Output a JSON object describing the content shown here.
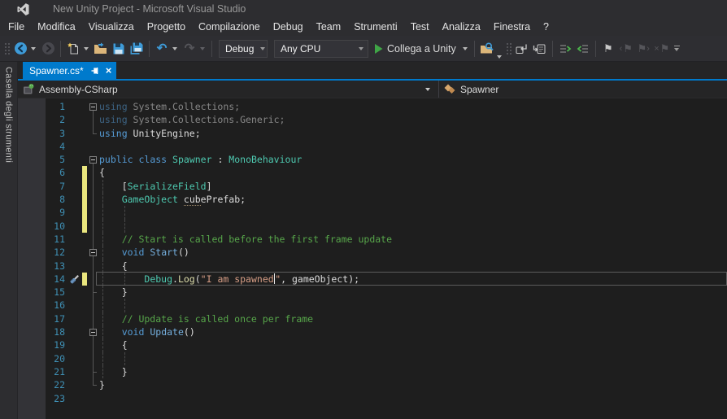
{
  "window": {
    "title": "New Unity Project - Microsoft Visual Studio"
  },
  "menu": [
    "File",
    "Modifica",
    "Visualizza",
    "Progetto",
    "Compilazione",
    "Debug",
    "Team",
    "Strumenti",
    "Test",
    "Analizza",
    "Finestra",
    "?"
  ],
  "toolbar": {
    "configuration": "Debug",
    "platform": "Any CPU",
    "attach": "Collega a Unity",
    "glyphs": {
      "undo": "↶",
      "redo": "↷",
      "flag": "⚑",
      "prev": "‹",
      "next": "›",
      "clear": "×"
    }
  },
  "document": {
    "tab": "Spawner.cs*",
    "close": "×",
    "project_dropdown": "Assembly-CSharp",
    "type_dropdown": "Spawner"
  },
  "toolbox": {
    "label": "Casella degli strumenti"
  },
  "colors": {
    "accent": "#007ACC",
    "editor_bg": "#1E1E1E",
    "chrome_bg": "#2D2D30",
    "keyword": "#569CD6",
    "type": "#4EC9B0",
    "unity_message": "#74AEDC",
    "method": "#DCDCAA",
    "string": "#D69D85",
    "comment": "#57A64A",
    "plain": "#DCDCDC",
    "line_number": "#3F90B5",
    "change_bar": "#EAE67E"
  },
  "code": {
    "language": "csharp",
    "lines": [
      {
        "n": 1,
        "ol": "b",
        "fold": true,
        "fade": true,
        "t": [
          [
            "k",
            "using"
          ],
          [
            "p",
            " System.Collections;"
          ]
        ]
      },
      {
        "n": 2,
        "ol": "f",
        "fade": true,
        "t": [
          [
            "k",
            "using"
          ],
          [
            "p",
            " System.Collections.Generic;"
          ]
        ]
      },
      {
        "n": 3,
        "ol": "t",
        "hook": true,
        "t": [
          [
            "k",
            "using"
          ],
          [
            "p",
            " UnityEngine;"
          ]
        ]
      },
      {
        "n": 4,
        "ol": "",
        "t": []
      },
      {
        "n": 5,
        "ol": "b",
        "fold": true,
        "t": [
          [
            "k",
            "public"
          ],
          [
            "p",
            " "
          ],
          [
            "k",
            "class"
          ],
          [
            "p",
            " "
          ],
          [
            "t",
            "Spawner"
          ],
          [
            "p",
            " : "
          ],
          [
            "t",
            "MonoBehaviour"
          ]
        ]
      },
      {
        "n": 6,
        "ol": "f",
        "chg": true,
        "t": [
          [
            "p",
            "{"
          ]
        ]
      },
      {
        "n": 7,
        "ol": "f",
        "chg": true,
        "g": [
          0
        ],
        "t": [
          [
            "p",
            "    ["
          ],
          [
            "t",
            "SerializeField"
          ],
          [
            "p",
            "]"
          ]
        ]
      },
      {
        "n": 8,
        "ol": "f",
        "chg": true,
        "g": [
          0
        ],
        "t": [
          [
            "p",
            "    "
          ],
          [
            "t",
            "GameObject"
          ],
          [
            "p",
            " "
          ],
          [
            "f",
            "cub"
          ],
          [
            "p",
            "ePrefab;"
          ]
        ]
      },
      {
        "n": 9,
        "ol": "f",
        "chg": true,
        "g": [
          0,
          1
        ],
        "t": []
      },
      {
        "n": 10,
        "ol": "f",
        "chg": true,
        "g": [
          0,
          1
        ],
        "t": []
      },
      {
        "n": 11,
        "ol": "f",
        "g": [
          0
        ],
        "t": [
          [
            "c",
            "    // Start is called before the first frame update"
          ]
        ]
      },
      {
        "n": 12,
        "ol": "f",
        "fold": true,
        "g": [
          0
        ],
        "t": [
          [
            "p",
            "    "
          ],
          [
            "k",
            "void"
          ],
          [
            "p",
            " "
          ],
          [
            "m",
            "Start"
          ],
          [
            "p",
            "()"
          ]
        ]
      },
      {
        "n": 13,
        "ol": "f",
        "g": [
          0
        ],
        "t": [
          [
            "p",
            "    {"
          ]
        ]
      },
      {
        "n": 14,
        "ol": "f",
        "chg": true,
        "cur": true,
        "quick": true,
        "g": [
          0,
          1
        ],
        "t": [
          [
            "p",
            "        "
          ],
          [
            "t",
            "Debug"
          ],
          [
            "p",
            "."
          ],
          [
            "d",
            "Log"
          ],
          [
            "p",
            "("
          ],
          [
            "s",
            "\"I am spawned"
          ],
          [
            "caret",
            ""
          ],
          [
            "s",
            "\""
          ],
          [
            "p",
            ", gameObject);"
          ]
        ]
      },
      {
        "n": 15,
        "ol": "f",
        "hook": true,
        "g": [
          0
        ],
        "t": [
          [
            "p",
            "    }"
          ]
        ]
      },
      {
        "n": 16,
        "ol": "f",
        "g": [
          0,
          1
        ],
        "t": []
      },
      {
        "n": 17,
        "ol": "f",
        "g": [
          0
        ],
        "t": [
          [
            "c",
            "    // Update is called once per frame"
          ]
        ]
      },
      {
        "n": 18,
        "ol": "f",
        "fold": true,
        "g": [
          0
        ],
        "t": [
          [
            "p",
            "    "
          ],
          [
            "k",
            "void"
          ],
          [
            "p",
            " "
          ],
          [
            "m",
            "Update"
          ],
          [
            "p",
            "()"
          ]
        ]
      },
      {
        "n": 19,
        "ol": "f",
        "g": [
          0
        ],
        "t": [
          [
            "p",
            "    {"
          ]
        ]
      },
      {
        "n": 20,
        "ol": "f",
        "g": [
          0,
          1
        ],
        "t": []
      },
      {
        "n": 21,
        "ol": "f",
        "hook": true,
        "g": [
          0
        ],
        "t": [
          [
            "p",
            "    }"
          ]
        ]
      },
      {
        "n": 22,
        "ol": "t",
        "hook": true,
        "t": [
          [
            "p",
            "}"
          ]
        ]
      },
      {
        "n": 23,
        "ol": "",
        "t": []
      }
    ]
  }
}
